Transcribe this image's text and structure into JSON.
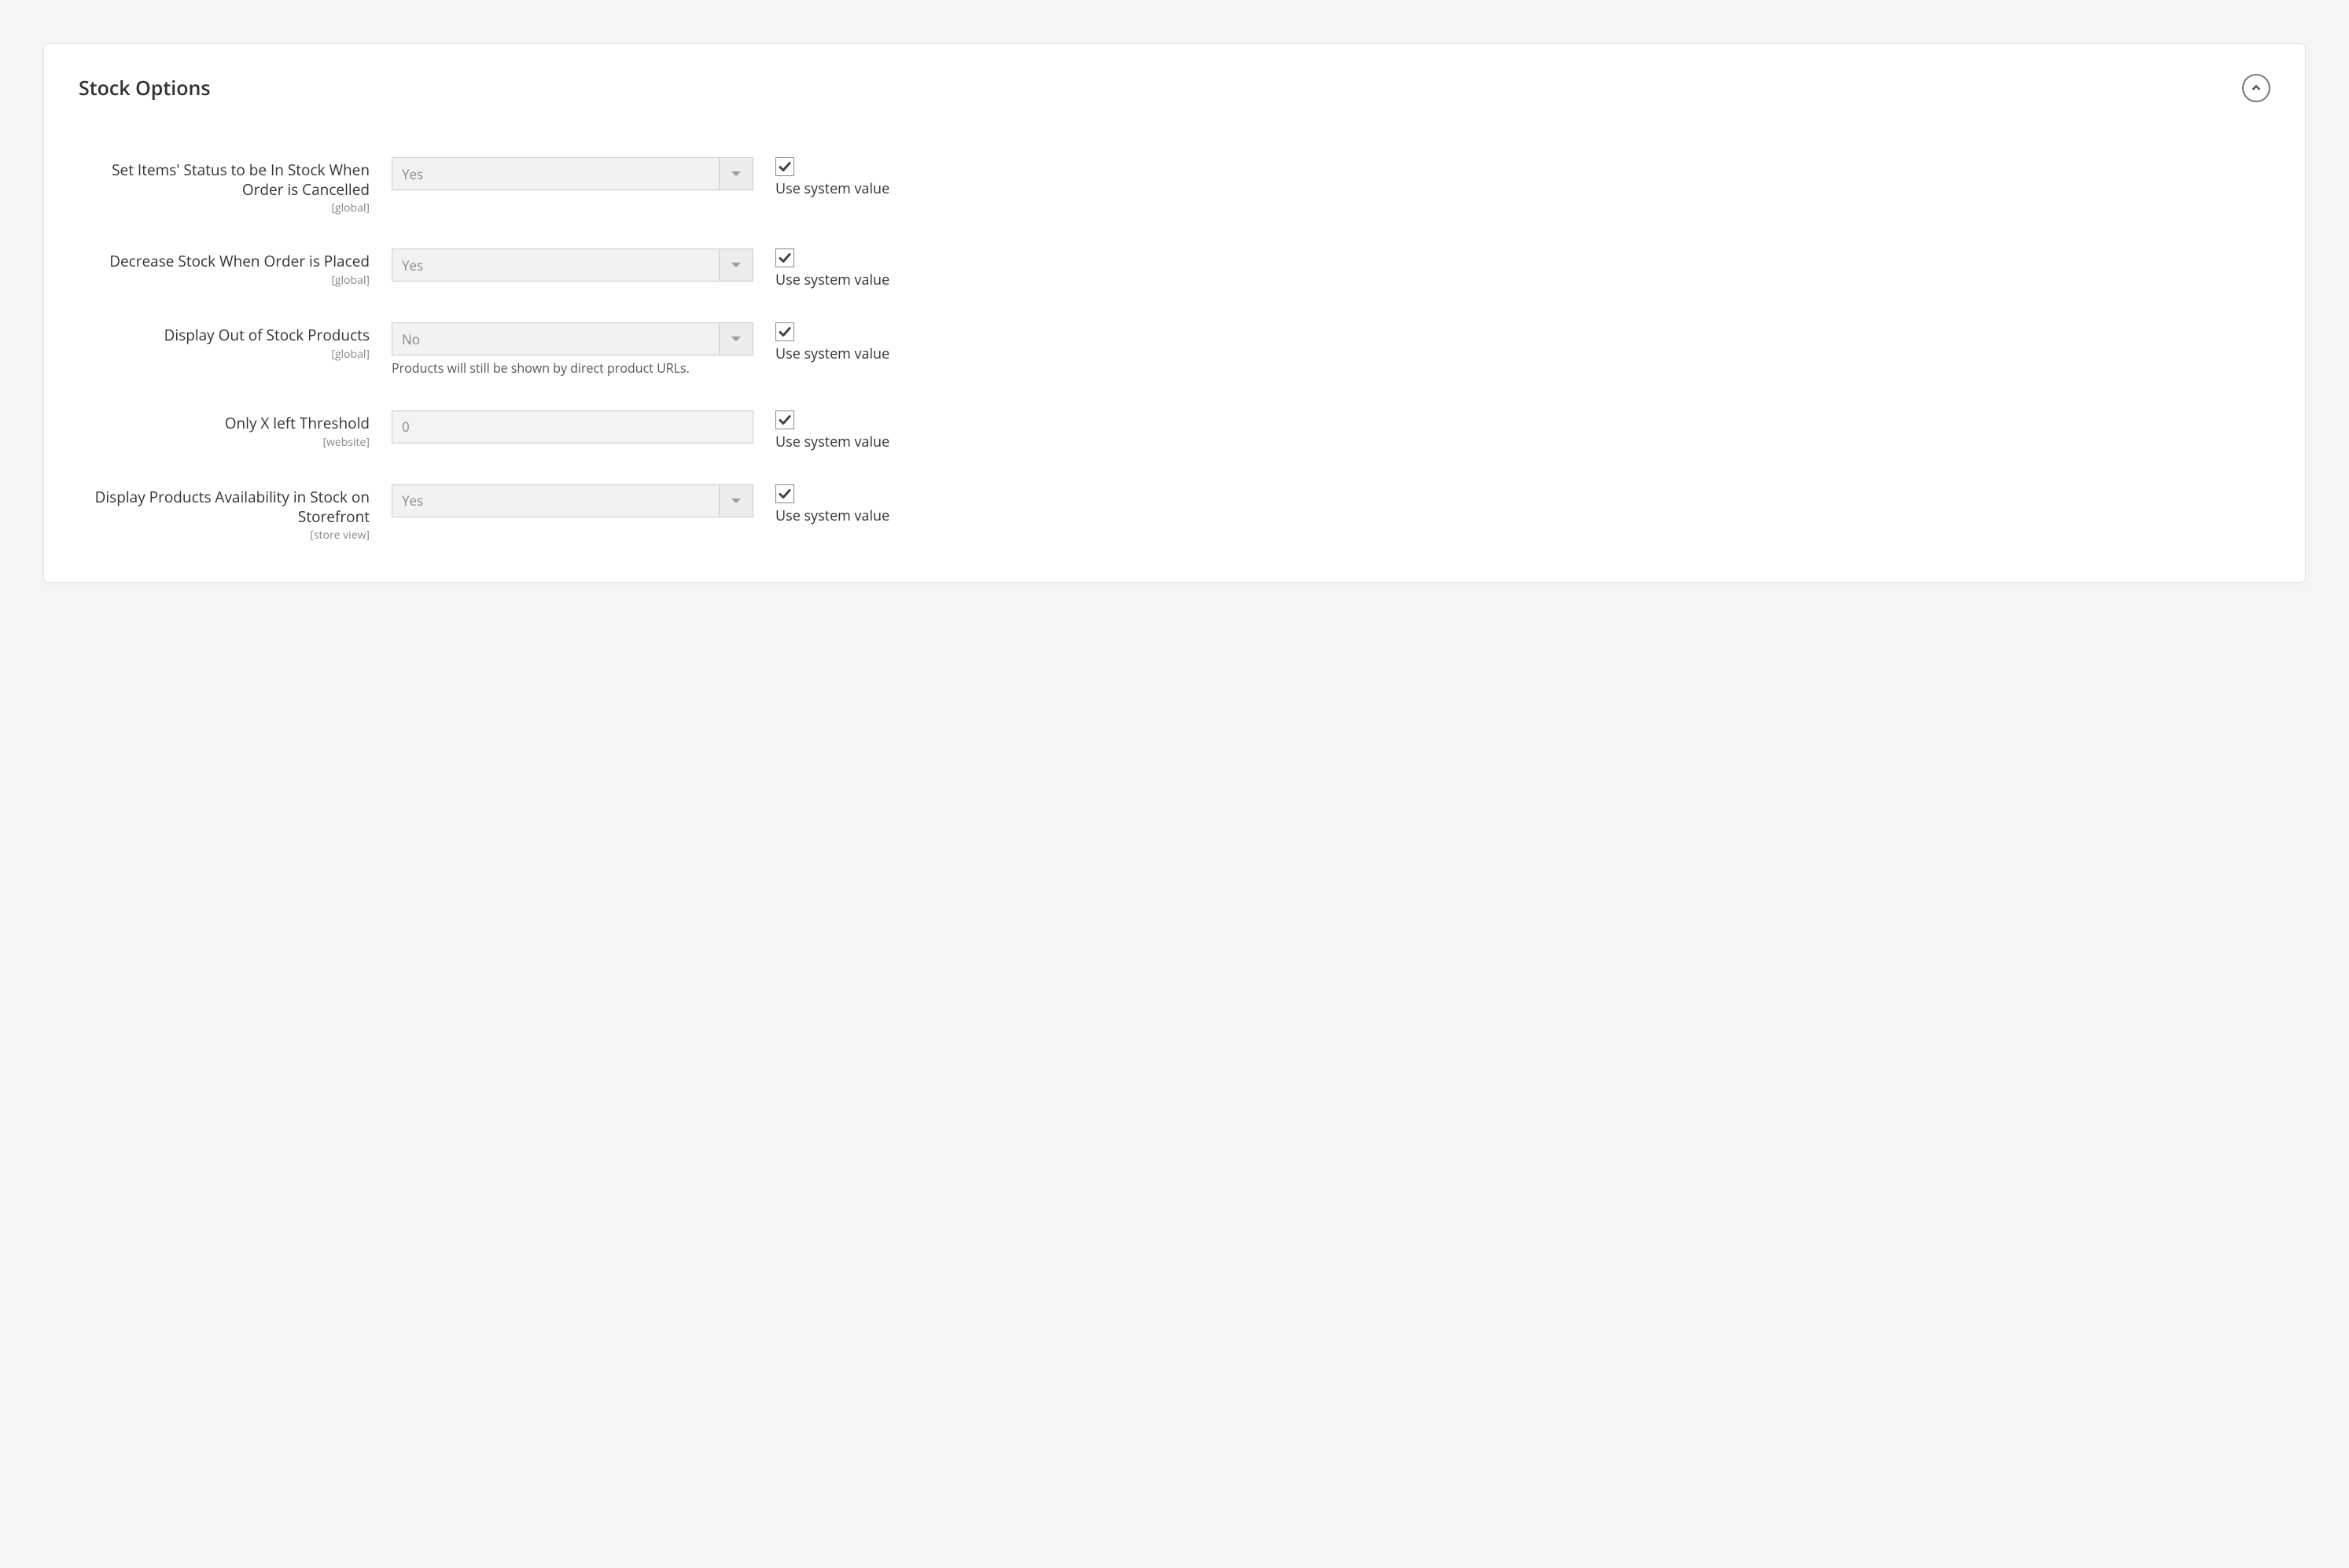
{
  "panel": {
    "title": "Stock Options",
    "use_system_label": "Use system value"
  },
  "rows": [
    {
      "id": "set-in-stock-cancel",
      "label": "Set Items' Status to be In Stock When Order is Cancelled",
      "scope": "[global]",
      "type": "select",
      "value": "Yes",
      "hint": "",
      "use_system": true
    },
    {
      "id": "decrease-stock-placed",
      "label": "Decrease Stock When Order is Placed",
      "scope": "[global]",
      "type": "select",
      "value": "Yes",
      "hint": "",
      "use_system": true
    },
    {
      "id": "display-out-of-stock",
      "label": "Display Out of Stock Products",
      "scope": "[global]",
      "type": "select",
      "value": "No",
      "hint": "Products will still be shown by direct product URLs.",
      "use_system": true
    },
    {
      "id": "only-x-left",
      "label": "Only X left Threshold",
      "scope": "[website]",
      "type": "text",
      "value": "0",
      "hint": "",
      "use_system": true
    },
    {
      "id": "display-availability",
      "label": "Display Products Availability in Stock on Storefront",
      "scope": "[store view]",
      "type": "select",
      "value": "Yes",
      "hint": "",
      "use_system": true
    }
  ]
}
